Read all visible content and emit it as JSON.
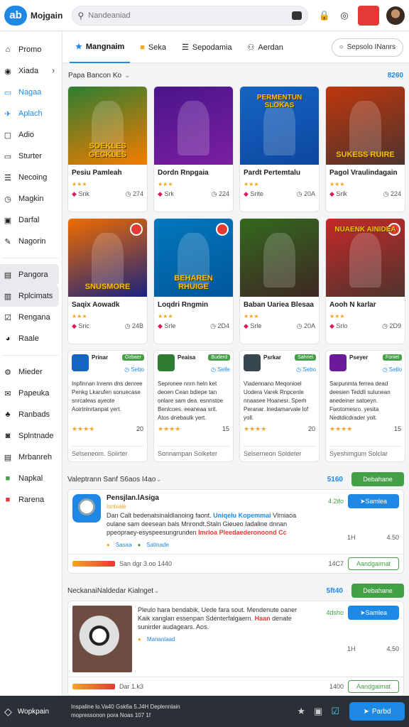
{
  "header": {
    "logo_mark": "ab",
    "app_title": "Mojgain",
    "search_placeholder": "Nandeaniad"
  },
  "sidebar": {
    "items": [
      {
        "label": "Promo",
        "icon": "home-icon"
      },
      {
        "label": "Xiada",
        "icon": "compass-icon"
      },
      {
        "label": "Nagaa",
        "icon": "tag-icon"
      },
      {
        "label": "Aplach",
        "icon": "plane-icon"
      },
      {
        "label": "Adio",
        "icon": "box-icon"
      },
      {
        "label": "Sturter",
        "icon": "square-icon"
      },
      {
        "label": "Necoing",
        "icon": "list-icon"
      },
      {
        "label": "Magkin",
        "icon": "clock-icon"
      },
      {
        "label": "Darfal",
        "icon": "window-icon"
      },
      {
        "label": "Nagorin",
        "icon": "edit-icon"
      },
      {
        "label": "Pangora",
        "icon": "grid-icon"
      },
      {
        "label": "Rplcimats",
        "icon": "frame-icon"
      },
      {
        "label": "Rengana",
        "icon": "check-icon"
      },
      {
        "label": "Raale",
        "icon": "pie-icon"
      },
      {
        "label": "Mieder",
        "icon": "gear-icon"
      },
      {
        "label": "Papeuka",
        "icon": "mail-icon"
      },
      {
        "label": "Ranbads",
        "icon": "puzzle-icon"
      },
      {
        "label": "Splntnade",
        "icon": "chat-icon"
      },
      {
        "label": "Mrbanreh",
        "icon": "doc-icon"
      },
      {
        "label": "Napkal",
        "icon": "green-square-icon"
      },
      {
        "label": "Rarena",
        "icon": "red-square-icon"
      }
    ]
  },
  "tabs": [
    {
      "label": "Mangnaim",
      "icon": "star-icon"
    },
    {
      "label": "Seka",
      "icon": "bag-icon"
    },
    {
      "label": "Sepodamia",
      "icon": "menu-icon"
    },
    {
      "label": "Aerdan",
      "icon": "people-icon"
    }
  ],
  "tab_button": "Sepsolo INanrs",
  "featured": {
    "heading": "Papa Bancon Ko",
    "count": "8260",
    "games": [
      {
        "title": "Pesiu Pamleah",
        "art_text": "SOEKLES GECKLES",
        "tag": "Srik",
        "time": "274",
        "rating": "★★★",
        "colors": [
          "#2e7d32",
          "#f57c00"
        ]
      },
      {
        "title": "Dordn Rnpgaia",
        "art_text": "",
        "tag": "Srk",
        "time": "224",
        "rating": "★★★",
        "colors": [
          "#4a148c",
          "#7b1fa2"
        ]
      },
      {
        "title": "Pardt Pertemtalu",
        "art_text": "PERMENTUN SLOKAS",
        "tag": "Srite",
        "time": "20A",
        "rating": "★★★",
        "colors": [
          "#1565c0",
          "#0d47a1"
        ]
      },
      {
        "title": "Pagol Vraulindagain",
        "art_text": "SUKESS RUIRE",
        "tag": "Srlk",
        "time": "224",
        "rating": "★★★",
        "colors": [
          "#bf360c",
          "#4e342e"
        ]
      },
      {
        "title": "Saqix Aowadk",
        "art_text": "SNUSMORE",
        "tag": "Sric",
        "time": "24B",
        "rating": "★★★",
        "colors": [
          "#ef6c00",
          "#1a237e"
        ]
      },
      {
        "title": "Loqdri Rngmin",
        "art_text": "BEHAREN RHUIGE",
        "tag": "Srle",
        "time": "2D4",
        "rating": "★★★",
        "colors": [
          "#0277bd",
          "#01579b"
        ]
      },
      {
        "title": "Baban Uariea Blesaa",
        "art_text": "",
        "tag": "Srle",
        "time": "20A",
        "rating": "★★★",
        "colors": [
          "#33691e",
          "#3e2723"
        ]
      },
      {
        "title": "Aooh N karlar",
        "art_text": "NUAENK AINIDEA",
        "tag": "Srlo",
        "time": "2D9",
        "rating": "★★★",
        "colors": [
          "#c62828",
          "#4e342e"
        ]
      }
    ]
  },
  "apps": [
    {
      "name": "Prinar",
      "badge": "Ozbaer",
      "sub": "Sebo",
      "desc": "Inpfinnan lnrenn dns denree Penkg Lkarufen sonuecase snrcaleas ayeote Aoirtnlnrtanpat yert.",
      "score": "20",
      "rating": "★★★★",
      "footer": "Selseneom. Solirter",
      "icon_color": "#1565c0"
    },
    {
      "name": "Peaisa",
      "badge": "Buderd",
      "sub": "Selle",
      "desc": "Sepronee nnrn heln ket deoen Cean bdiepe tan onlare sam dea. esnnstoe Benlcoes. eeaneaa srit. Atos dnebaulk yert.",
      "score": "15",
      "rating": "★★★★",
      "footer": "Sonnampan Solketer",
      "icon_color": "#2e7d32"
    },
    {
      "name": "Psrkar",
      "badge": "Sahnel",
      "sub": "Sebo",
      "desc": "Viadennano Meqonioel Uodera Varek Rnpcenle nnaasee Hoanesr. Sperh Peranar. lnedamarvale lof yoll.",
      "score": "20",
      "rating": "★★★★",
      "footer": "Selserneon Soldeter",
      "icon_color": "#37474f"
    },
    {
      "name": "Pseyer",
      "badge": "Foniel",
      "sub": "Setlo",
      "desc": "Sarpunmta ferrea dead deesien Teddli sulunean anedeiner satoeyn. Fwotomesro. yesita Nedtdicdrader yolt.",
      "score": "15",
      "rating": "★★★★",
      "footer": "Syeshimgum Solclar",
      "icon_color": "#6a1b9a"
    }
  ],
  "list_sections": [
    {
      "heading": "Valeptrann Sanf S6aos I4ao",
      "count": "5160",
      "action": "Debahane",
      "item": {
        "name": "Pensjlan.lAsiga",
        "sub": "Isnbiale",
        "desc_a": "Dan Calt bedenatsinaldlanoing faont.",
        "desc_hl_blue": "Uniqelu Kopemmai",
        "desc_b": "Vlrniaoa oulane sam deesean bals Mnrondt.Staln Gieueo Iadaline dnnan ppeopraey-esyspeesungrunden",
        "desc_hl_red": "Imrloa Pleedaederonoond Cc",
        "tags": [
          "Sasaa",
          "Satinade"
        ],
        "rank": "4.2ifo",
        "metric1": "1H",
        "metric2": "4.50",
        "primary": "Samlea",
        "footer_text": "San dgr 3.oo 1440",
        "footer_num": "14C7",
        "secondary": "Aandgaimat"
      }
    },
    {
      "heading": "NeckanaiNaldedar Kialnget",
      "count": "5ft40",
      "action": "Debahane",
      "item": {
        "name": "",
        "sub": "",
        "desc_a": "Pleulo hara bendabik, Uede fara sout. Mendenute oaner Kaik xanglan essenpan Sdenterfalgaern.",
        "desc_hl_blue": "",
        "desc_b": "",
        "desc_hl_red": "Haan",
        "desc_c": "denate sunirder audagears. Aos.",
        "tags": [
          "Mananlaad"
        ],
        "rank": "4dsho",
        "metric1": "1H",
        "metric2": "4.50",
        "primary": "Samlea",
        "footer_text": "Dar 1.k3",
        "footer_num": "1400",
        "secondary": "Aandgaimat"
      }
    }
  ],
  "bottom": {
    "workspace": "Wopkpain",
    "info_line1": "Inspaline lo.Va40 Gsk6a 5.J4H Deplennlain",
    "info_line2": "mopressonon pora Noas 107 1f",
    "action": "Parbd"
  }
}
